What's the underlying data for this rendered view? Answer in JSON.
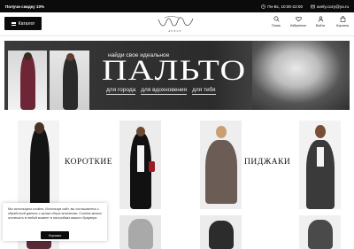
{
  "topbar": {
    "promo": "Получи скидку 10%",
    "hours": "Пн-Вс, 10:00-22:00",
    "email": "avely.cozy@ya.ru"
  },
  "header": {
    "catalog_label": "Каталог",
    "brand": "AVELY",
    "nav": [
      {
        "label": "Поиск",
        "icon": "search-icon"
      },
      {
        "label": "Избранное",
        "icon": "heart-icon"
      },
      {
        "label": "Войти",
        "icon": "user-icon"
      },
      {
        "label": "Корзина",
        "icon": "bag-icon"
      }
    ]
  },
  "hero": {
    "subtitle": "найди свое идеальное",
    "title": "ПАЛЬТО",
    "tags": [
      "для города",
      "для вдохновения",
      "для тебя"
    ]
  },
  "categories": [
    {
      "label": "КОРОТКИЕ"
    },
    {
      "label": "ПИДЖАКИ"
    }
  ],
  "cookie": {
    "text": "Мы используем cookies. Используя сайт, вы соглашаетесь с обработкой данных с целью сбора аналитики. Cookies можно отключить в любой момент в настройках вашего браузера",
    "ok_label": "Хорошо"
  },
  "colors": {
    "dark": "#0b0b0b",
    "accent": "#ffffff"
  }
}
